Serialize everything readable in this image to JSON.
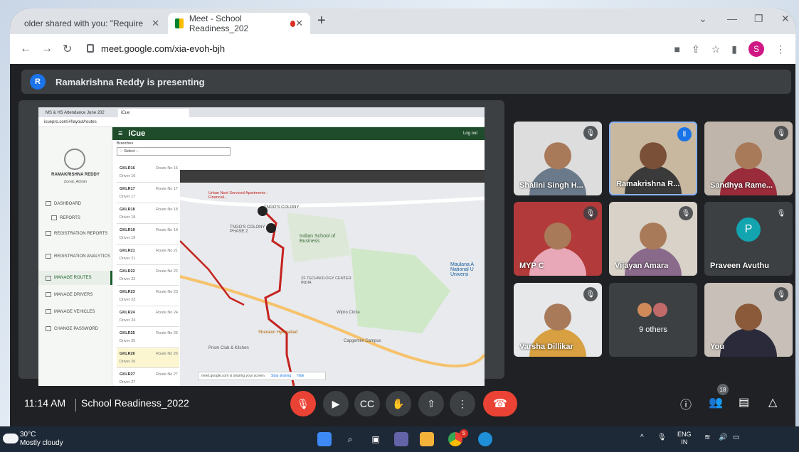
{
  "browser": {
    "tabs": [
      {
        "label": "older shared with you: \"Require",
        "active": false
      },
      {
        "label": "Meet - School Readiness_202",
        "active": true
      }
    ],
    "url": "meet.google.com/xia-evoh-bjh",
    "profile_initial": "S"
  },
  "banner": {
    "avatar": "R",
    "text": "Ramakrishna Reddy is presenting"
  },
  "shared": {
    "tabs": [
      "MS & HS Attendance June 202",
      "iCue"
    ],
    "url": "icuepro.com/#!layout/routes",
    "app_title": "iCue",
    "logout": "Log out",
    "user_name": "RAMAKRISHNA REDDY",
    "user_role": "Zonal_Admin",
    "menu": [
      "DASHBOARD",
      "REPORTS",
      "REGISTRATION REPORTS",
      "REGISTRATION ANALYTICS",
      "MANAGE ROUTES",
      "MANAGE DRIVERS",
      "MANAGE VEHICLES",
      "CHANGE PASSWORD"
    ],
    "branches_label": "Branches",
    "select_placeholder": "-- Select --",
    "routes": [
      {
        "code": "GKLR16",
        "route": "Route No 16",
        "driver": "Driver 16"
      },
      {
        "code": "GKLR17",
        "route": "Route No 17",
        "driver": "Driver 17"
      },
      {
        "code": "GKLR18",
        "route": "Route No 18",
        "driver": "Driver 18"
      },
      {
        "code": "GKLR19",
        "route": "Route No 19",
        "driver": "Driver 19"
      },
      {
        "code": "GKLR21",
        "route": "Route No 21",
        "driver": "Driver 21"
      },
      {
        "code": "GKLR22",
        "route": "Route No 22",
        "driver": "Driver 22"
      },
      {
        "code": "GKLR23",
        "route": "Route No 23",
        "driver": "Driver 23"
      },
      {
        "code": "GKLR24",
        "route": "Route No 24",
        "driver": "Driver 24"
      },
      {
        "code": "GKLR25",
        "route": "Route No 25",
        "driver": "Driver 25"
      },
      {
        "code": "GKLR26",
        "route": "Route No 26",
        "driver": "Driver 26"
      },
      {
        "code": "GKLR27",
        "route": "Route No 27",
        "driver": "Driver 27"
      }
    ],
    "map_labels": [
      "TNGO'S COLONY",
      "TNGO'S COLONY PHASE 2",
      "Indian School of Business",
      "Urban Nest Serviced Apartments - Financial...",
      "ZF TECHNOLOGY CENTER INDIA",
      "Sheraton Hyderabad",
      "Prism Club & Kitchen",
      "Wipro Circle",
      "Capgemini Campus",
      "Maulana A National U Universi"
    ],
    "share_notice": "meet.google.com is sharing your screen.",
    "stop_sharing": "Stop sharing",
    "hide": "Hide"
  },
  "participants": [
    {
      "name": "Shalini Singh H...",
      "muted": true
    },
    {
      "name": "Ramakrishna R...",
      "speaking": true
    },
    {
      "name": "Sandhya Rame...",
      "muted": true
    },
    {
      "name": "MYP C",
      "muted": true
    },
    {
      "name": "Vijayan Amara",
      "muted": true
    },
    {
      "name": "Praveen Avuthu",
      "muted": true,
      "initial": "P"
    },
    {
      "name": "Varsha Dillikar",
      "muted": true
    },
    {
      "name": "9 others"
    },
    {
      "name": "You",
      "muted": true
    }
  ],
  "controls": {
    "time": "11:14 AM",
    "meeting_name": "School Readiness_2022",
    "people_count": "18"
  },
  "taskbar": {
    "temp": "30°C",
    "weather": "Mostly cloudy",
    "lang1": "ENG",
    "lang2": "IN",
    "chrome_badge": "5"
  },
  "colors": {
    "accent": "#1a73e8",
    "end_call": "#ea4335",
    "icue_green": "#1f4d2b"
  }
}
